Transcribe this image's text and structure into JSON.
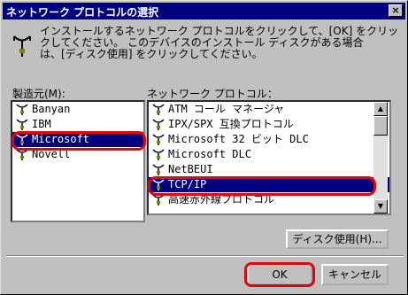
{
  "window": {
    "title": "ネットワーク プロトコルの選択",
    "close_label": "×"
  },
  "instructions": {
    "line1": "インストールするネットワーク プロトコルをクリックして、[OK] をクリッ",
    "line2": "クしてください。 このデバイスのインストール ディスクがある場合",
    "line3": "は、[ディスク使用] をクリックしてください。"
  },
  "manufacturers": {
    "label": "製造元(M):",
    "items": [
      "Banyan",
      "IBM",
      "Microsoft",
      "Novell"
    ],
    "selected": "Microsoft"
  },
  "protocols": {
    "label": "ネットワーク プロトコル：",
    "items": [
      "ATM コール マネージャ",
      "IPX/SPX 互換プロトコル",
      "Microsoft 32 ビット DLC",
      "Microsoft DLC",
      "NetBEUI",
      "TCP/IP",
      "高速赤外線プロトコル"
    ],
    "selected": "TCP/IP"
  },
  "buttons": {
    "have_disk": "ディスク使用(H)...",
    "ok": "OK",
    "cancel": "キャンセル"
  },
  "colors": {
    "highlight_ring": "#e8000b",
    "selection": "#000080"
  }
}
